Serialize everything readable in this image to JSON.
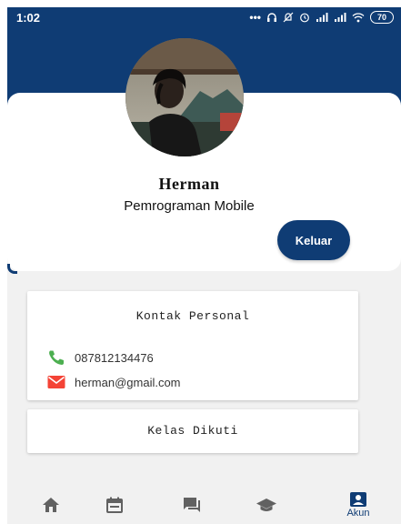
{
  "status_bar": {
    "time": "1:02",
    "icons": [
      "more-dots-icon",
      "headphones-icon",
      "mute-icon",
      "alarm-icon",
      "signal-icon",
      "signal-icon",
      "wifi-icon"
    ],
    "battery": "70"
  },
  "profile": {
    "name": "Herman",
    "subtitle": "Pemrograman Mobile",
    "logout_label": "Keluar"
  },
  "contact": {
    "title": "Kontak Personal",
    "phone": "087812134476",
    "email": "herman@gmail.com"
  },
  "classes": {
    "title": "Kelas Dikuti"
  },
  "bottom_nav": {
    "items": [
      {
        "icon": "home-icon"
      },
      {
        "icon": "calendar-icon"
      },
      {
        "icon": "chat-icon"
      },
      {
        "icon": "graduation-cap-icon"
      },
      {
        "icon": "account-icon",
        "label": "Akun",
        "active": true
      }
    ]
  },
  "colors": {
    "primary": "#0f3c74",
    "background": "#f1f1f1",
    "phone_icon": "#4caf50",
    "email_icon": "#f44336",
    "nav_inactive": "#616161"
  }
}
